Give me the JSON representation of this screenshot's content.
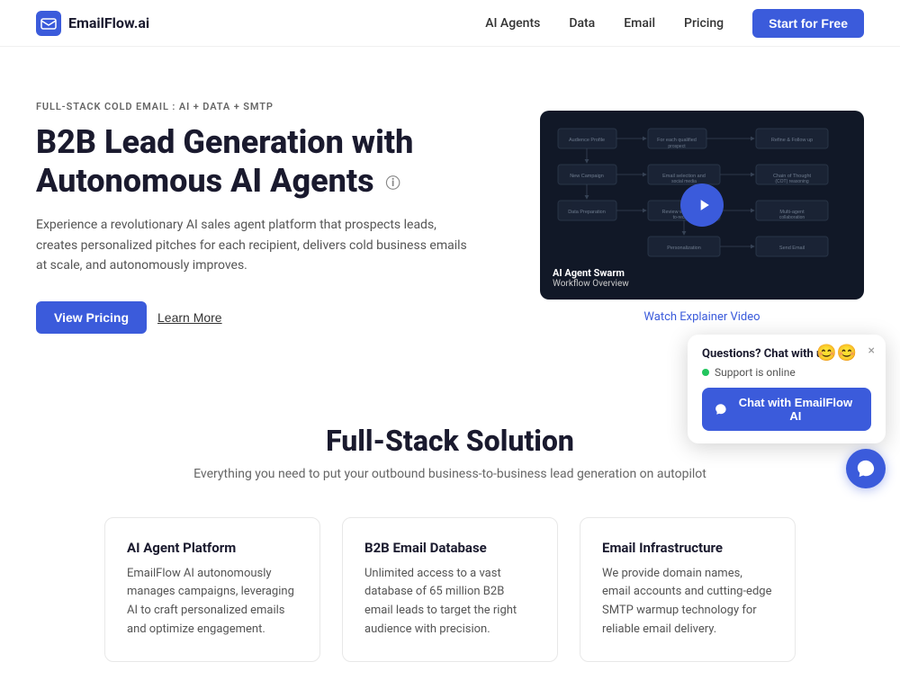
{
  "nav": {
    "logo_text": "EmailFlow.ai",
    "links": [
      {
        "label": "AI Agents",
        "href": "#"
      },
      {
        "label": "Data",
        "href": "#"
      },
      {
        "label": "Email",
        "href": "#"
      },
      {
        "label": "Pricing",
        "href": "#"
      }
    ],
    "cta_label": "Start for Free"
  },
  "hero": {
    "tag": "FULL-STACK COLD EMAIL : AI + DATA + SMTP",
    "title_line1": "B2B Lead Generation with",
    "title_line2": "Autonomous AI Agents",
    "description": "Experience a revolutionary AI sales agent platform that prospects leads, creates personalized pitches for each recipient, delivers cold business emails at scale, and autonomously improves.",
    "btn_primary": "View Pricing",
    "btn_secondary": "Learn More",
    "video_label_title": "AI Agent Swarm",
    "video_label_sub": "Workflow Overview",
    "video_link": "Watch Explainer Video"
  },
  "fullstack": {
    "title": "Full-Stack Solution",
    "subtitle": "Everything you need to put your outbound business-to-business lead generation on autopilot",
    "cards": [
      {
        "title": "AI Agent Platform",
        "desc": "EmailFlow AI autonomously manages campaigns, leveraging AI to craft personalized emails and optimize engagement."
      },
      {
        "title": "B2B Email Database",
        "desc": "Unlimited access to a vast database of 65 million B2B email leads to target the right audience with precision."
      },
      {
        "title": "Email Infrastructure",
        "desc": "We provide domain names, email accounts and cutting-edge SMTP warmup technology for reliable email delivery."
      }
    ]
  },
  "chat": {
    "header": "Questions? Chat with us!",
    "status": "Support is online",
    "btn_label": "Chat with EmailFlow AI",
    "close_label": "×"
  }
}
